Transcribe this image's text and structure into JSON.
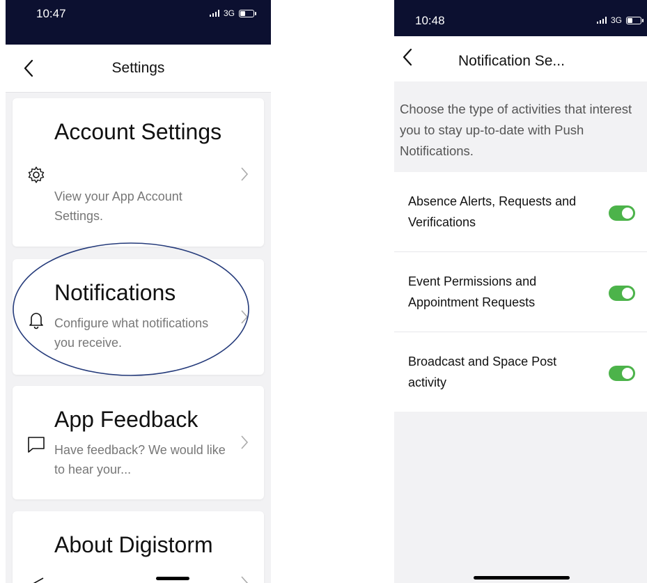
{
  "left_screen": {
    "status_bar": {
      "time": "10:47",
      "network": "3G"
    },
    "nav": {
      "title": "Settings"
    },
    "cards": [
      {
        "icon": "gear-icon",
        "title": "Account Settings",
        "description": "View your App Account Settings."
      },
      {
        "icon": "bell-icon",
        "title": "Notifications",
        "description": "Configure what notifications you receive."
      },
      {
        "icon": "chat-bubble-icon",
        "title": "App Feedback",
        "description": "Have feedback? We would like to hear your..."
      },
      {
        "icon": "send-icon",
        "title": "About Digistorm",
        "description": ""
      }
    ],
    "annotation_color": "#243a7a"
  },
  "right_screen": {
    "status_bar": {
      "time": "10:48",
      "network": "3G"
    },
    "nav": {
      "title": "Notification Se..."
    },
    "intro": "Choose the type of activities that interest you to stay up-to-date with Push Notifications.",
    "settings": [
      {
        "label": "Absence Alerts, Requests and Verifications",
        "enabled": true
      },
      {
        "label": "Event Permissions and Appointment Requests",
        "enabled": true
      },
      {
        "label": "Broadcast and Space Post activity",
        "enabled": true
      }
    ],
    "toggle_on_color": "#4cb34a"
  },
  "colors": {
    "status_bar": "#0c1030",
    "background": "#f2f2f4"
  }
}
